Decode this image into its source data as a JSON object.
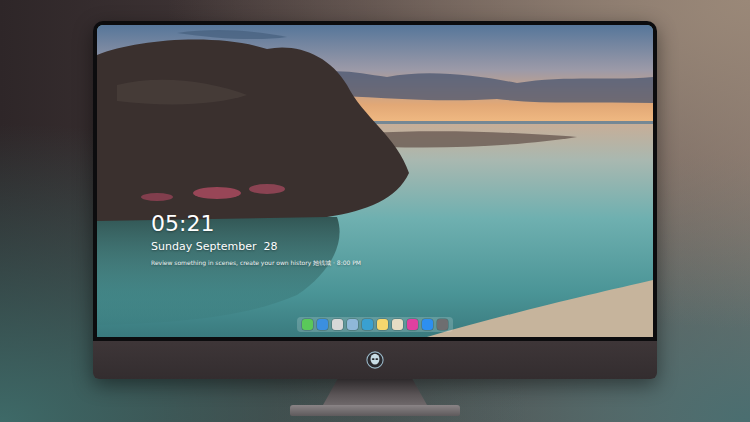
{
  "lock_screen": {
    "time": "05:21",
    "date": "Sunday September  28",
    "note": "Review something in scenes, create your own history 她钱城 · 8:00 PM"
  },
  "dock": {
    "items": [
      {
        "color": "#5ac85a"
      },
      {
        "color": "#3b8fe0"
      },
      {
        "color": "#d8d8d8"
      },
      {
        "color": "#8fb8d8"
      },
      {
        "color": "#3aa0d0"
      },
      {
        "color": "#f5d76e"
      },
      {
        "color": "#e6dcc4"
      },
      {
        "color": "#e040a0"
      },
      {
        "color": "#2d8ff0"
      },
      {
        "color": "#6e6e70"
      }
    ]
  }
}
